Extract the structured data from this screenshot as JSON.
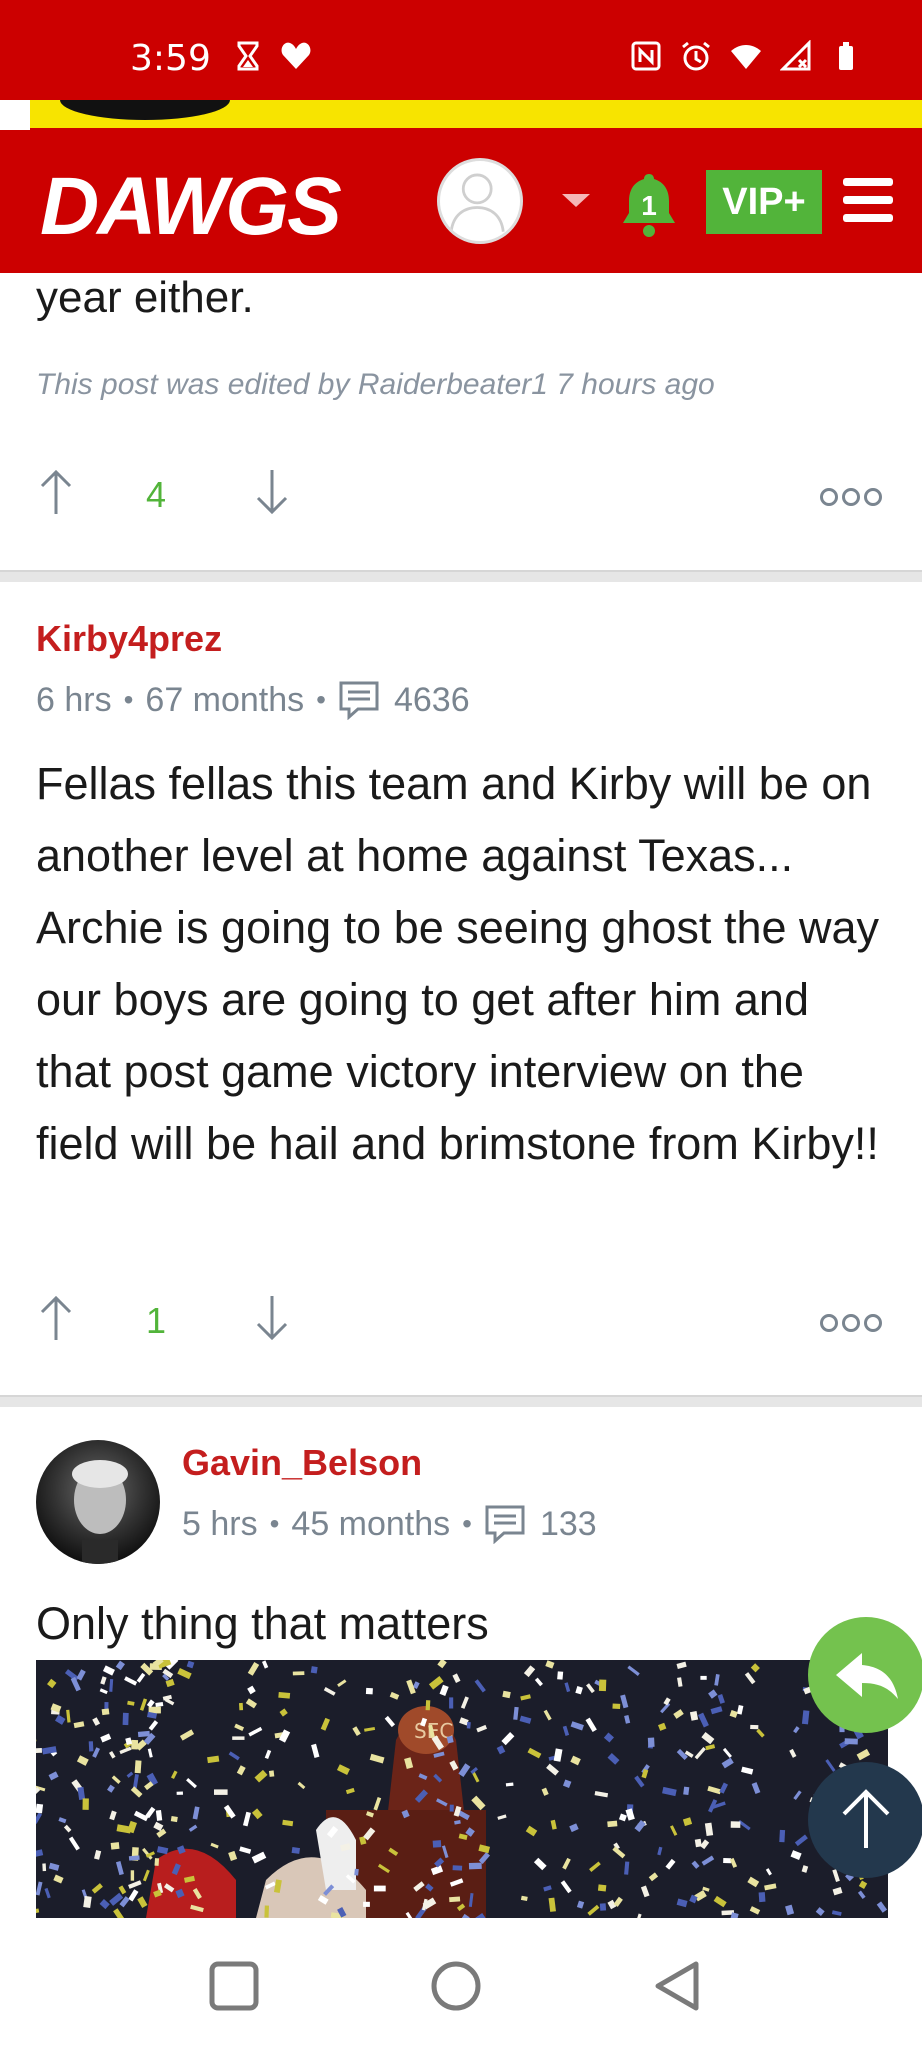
{
  "status_bar": {
    "time": "3:59",
    "left_icons": [
      "hourglass-icon",
      "heart-icon"
    ],
    "right_icons": [
      "nfc-icon",
      "alarm-icon",
      "wifi-icon",
      "signal-icon",
      "battery-icon"
    ],
    "bg_color": "#cc0000"
  },
  "header": {
    "logo": "DAWGS",
    "notification_count": "1",
    "vip_label": "VIP+",
    "accent_color": "#cc0000",
    "vip_color": "#52b43a"
  },
  "posts": [
    {
      "tail_text": "year either.",
      "edited_note": "This post was edited by Raiderbeater1 7 hours ago",
      "votes": "4"
    },
    {
      "username": "Kirby4prez",
      "age": "6 hrs",
      "tenure": "67 months",
      "post_count": "4636",
      "body": "Fellas fellas this team and Kirby will be on another level at home against Texas... Archie is going to be seeing ghost the way our boys are going to get after him and that post game victory interview on the field will be hail and brimstone from Kirby!!",
      "votes": "1"
    },
    {
      "username": "Gavin_Belson",
      "age": "5 hrs",
      "tenure": "45 months",
      "post_count": "133",
      "body": "Only thing that matters",
      "image_alt": "Trophy celebration with confetti",
      "image_text": "SEC"
    }
  ],
  "fabs": {
    "reply_icon": "reply-icon",
    "scroll_top_icon": "arrow-up-icon"
  },
  "nav": [
    "recents-button",
    "home-button",
    "back-button"
  ]
}
